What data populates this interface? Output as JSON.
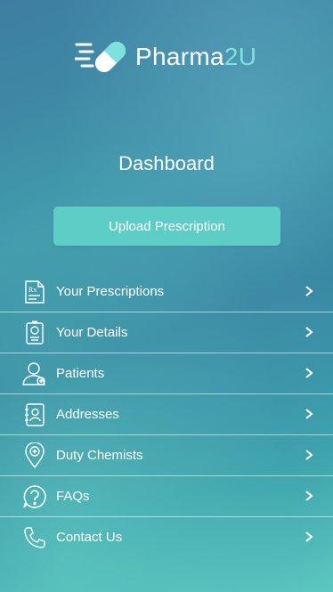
{
  "brand": {
    "name_main": "Pharma",
    "name_accent": "2U"
  },
  "page": {
    "title": "Dashboard"
  },
  "actions": {
    "upload_label": "Upload Prescription"
  },
  "menu": {
    "items": [
      {
        "label": "Your Prescriptions",
        "icon": "prescription-icon"
      },
      {
        "label": "Your Details",
        "icon": "id-badge-icon"
      },
      {
        "label": "Patients",
        "icon": "patient-icon"
      },
      {
        "label": "Addresses",
        "icon": "address-book-icon"
      },
      {
        "label": "Duty Chemists",
        "icon": "location-pin-icon"
      },
      {
        "label": "FAQs",
        "icon": "question-icon"
      },
      {
        "label": "Contact Us",
        "icon": "phone-icon"
      }
    ]
  },
  "colors": {
    "accent": "#5dcdc6",
    "brand_accent": "#7fe1dc"
  }
}
